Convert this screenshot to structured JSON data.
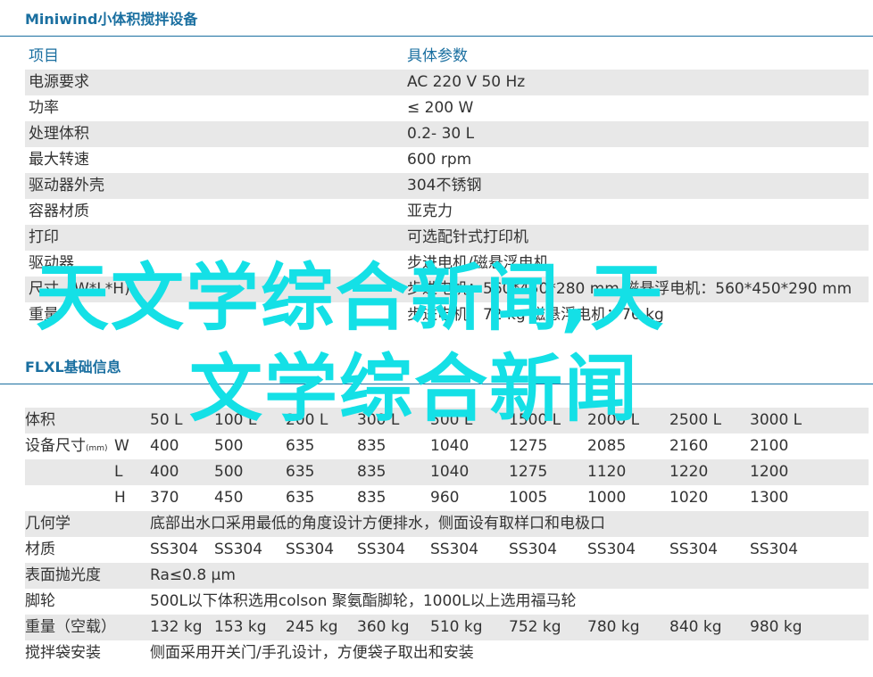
{
  "section1": {
    "title": "Miniwind小体积搅拌设备",
    "header": [
      "项目",
      "具体参数"
    ],
    "rows": [
      [
        "电源要求",
        "AC 220  V 50 Hz"
      ],
      [
        "功率",
        "≤ 200 W"
      ],
      [
        "处理体积",
        "0.2-  30 L"
      ],
      [
        "最大转速",
        "600  rpm"
      ],
      [
        "驱动器外壳",
        "304不锈钢"
      ],
      [
        "容器材质",
        "亚克力"
      ],
      [
        "打印",
        "可选配针式打印机"
      ],
      [
        "驱动器",
        "步进电机/磁悬浮电机"
      ],
      [
        "尺寸（W*L*H)",
        "步进电机：560*450*280 mm   磁悬浮电机：560*450*290 mm"
      ],
      [
        "重量",
        "步进电机：72 kg  磁悬浮电机：76 kg"
      ]
    ]
  },
  "section2": {
    "title": "FLXL基础信息",
    "volume_row": {
      "label": "体积",
      "values": [
        "50 L",
        "100 L",
        "200 L",
        "300 L",
        "500 L",
        "1500 L",
        "2000 L",
        "2500 L",
        "3000 L"
      ]
    },
    "size_rows": [
      {
        "label": "设备尺寸",
        "unit": "(mm)",
        "axis": "W",
        "values": [
          "400",
          "500",
          "635",
          "835",
          "1040",
          "1275",
          "2085",
          "2160",
          "2100"
        ]
      },
      {
        "label": "",
        "unit": "",
        "axis": "L",
        "values": [
          "400",
          "500",
          "635",
          "835",
          "1040",
          "1275",
          "1120",
          "1220",
          "1200"
        ]
      },
      {
        "label": "",
        "unit": "",
        "axis": "H",
        "values": [
          "370",
          "450",
          "635",
          "835",
          "960",
          "1005",
          "1000",
          "1020",
          "1300"
        ]
      }
    ],
    "geometry": {
      "label": "几何学",
      "value": "底部出水口采用最低的角度设计方便排水，侧面设有取样口和电极口"
    },
    "material_row": {
      "label": "材质",
      "values": [
        "SS304",
        "SS304",
        "SS304",
        "SS304",
        "SS304",
        "SS304",
        "SS304",
        "SS304",
        "SS304"
      ]
    },
    "polish": {
      "label": "表面抛光度",
      "value": "Ra≤0.8 μm"
    },
    "casters": {
      "label": "脚轮",
      "value": "500L以下体积选用colson 聚氨酯脚轮，1000L以上选用福马轮"
    },
    "weight_row": {
      "label": "重量（空载）",
      "values": [
        "132 kg",
        "153 kg",
        "245 kg",
        "360 kg",
        "510 kg",
        "752 kg",
        "780 kg",
        "840 kg",
        "980 kg"
      ]
    },
    "bag_install": {
      "label": "搅拌袋安装",
      "value": "侧面采用开关门/手孔设计，方便袋子取出和安装"
    }
  },
  "watermark": {
    "line1": "天文学综合新闻,天",
    "line2": "文学综合新闻",
    "color": "#14e0e6"
  },
  "colors": {
    "accent": "#1a6fa0",
    "shade": "#e8e8e8"
  }
}
